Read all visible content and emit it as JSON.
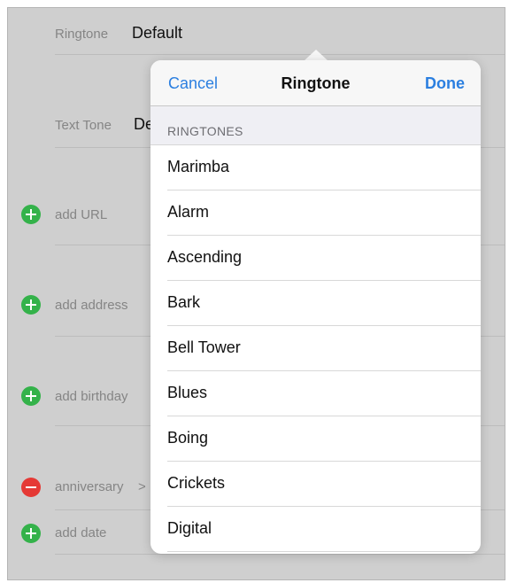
{
  "contact": {
    "ringtone_label": "Ringtone",
    "ringtone_value": "Default",
    "texttone_label": "Text Tone",
    "texttone_value": "Def",
    "add_url": "add URL",
    "add_address": "add address",
    "add_birthday": "add birthday",
    "anniversary": "anniversary",
    "anniversary_chevron": ">",
    "add_date": "add date"
  },
  "popover": {
    "cancel_label": "Cancel",
    "title": "Ringtone",
    "done_label": "Done",
    "section_header": "RINGTONES",
    "items": [
      "Marimba",
      "Alarm",
      "Ascending",
      "Bark",
      "Bell Tower",
      "Blues",
      "Boing",
      "Crickets",
      "Digital"
    ]
  },
  "colors": {
    "accent": "#2b7fe0",
    "add_green": "#34b24a",
    "remove_red": "#e53935"
  },
  "icons": {
    "add": "plus-circle-icon",
    "remove": "minus-circle-icon"
  }
}
